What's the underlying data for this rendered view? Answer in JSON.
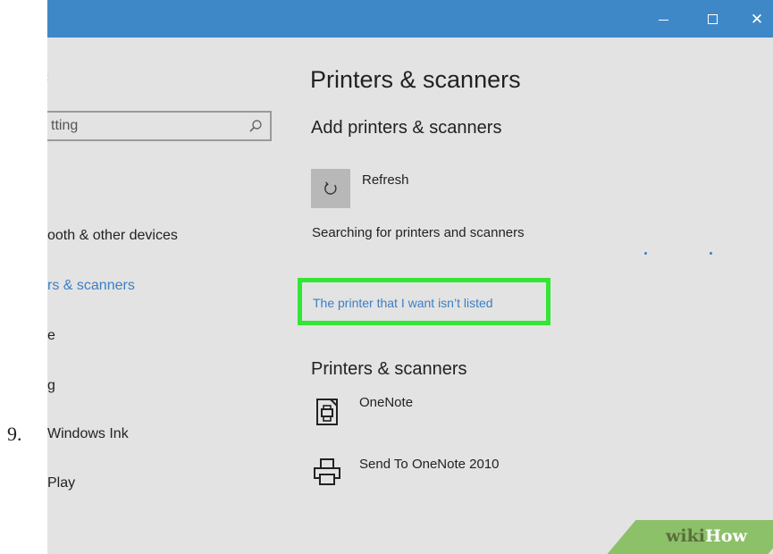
{
  "step_number": "9.",
  "window": {
    "controls": {
      "minimize": "−",
      "maximize": "□",
      "close": "✕"
    }
  },
  "sidebar": {
    "back_icon": "‹",
    "search": {
      "value": "tting",
      "icon": "search-icon"
    },
    "items": [
      {
        "label": "ooth & other devices",
        "active": false
      },
      {
        "label": "rs & scanners",
        "active": true
      },
      {
        "label": "e",
        "active": false
      },
      {
        "label": "g",
        "active": false
      },
      {
        "label": "Windows Ink",
        "active": false
      },
      {
        "label": "Play",
        "active": false
      }
    ]
  },
  "main": {
    "title": "Printers & scanners",
    "add_section": {
      "heading": "Add printers & scanners",
      "refresh_label": "Refresh",
      "status": "Searching for printers and scanners",
      "link": "The printer that I want isn’t listed"
    },
    "list_section": {
      "heading": "Printers & scanners",
      "printers": [
        {
          "name": "OneNote",
          "icon": "onenote-printer-icon"
        },
        {
          "name": "Send To OneNote 2010",
          "icon": "printer-icon"
        }
      ]
    }
  },
  "watermark": {
    "part1": "wiki",
    "part2": "How"
  },
  "colors": {
    "titlebar": "#3f88c8",
    "background": "#e3e3e3",
    "accent": "#3b7fc4",
    "highlight": "#32e634",
    "wikihow_green": "#8cc069"
  }
}
